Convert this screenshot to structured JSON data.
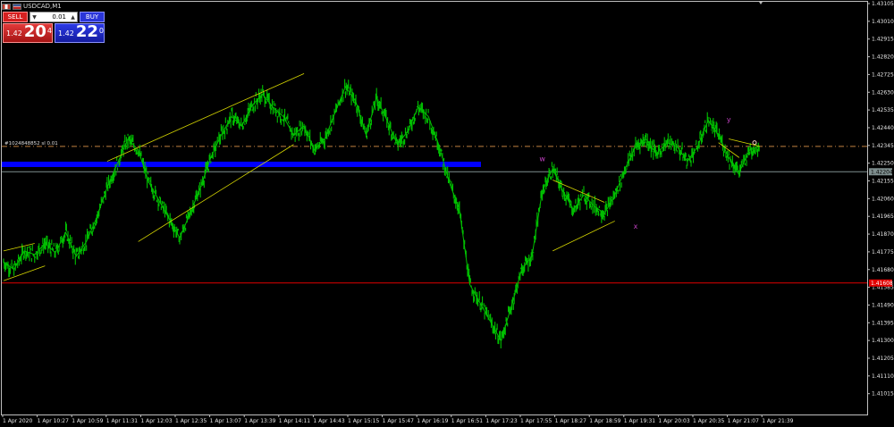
{
  "window": {
    "title": "USDCAD,M1"
  },
  "trade_panel": {
    "sell_label": "SELL",
    "buy_label": "BUY",
    "lot_value": "0.01",
    "sell_price": {
      "prefix": "1.42",
      "big": "20",
      "sup": "4"
    },
    "buy_price": {
      "prefix": "1.42",
      "big": "22",
      "sup": "0"
    }
  },
  "order_line_label": "#1024848852 sl 0.01",
  "bid_label": "1.42204",
  "stop_label": "1.41608",
  "wave_labels": [
    "w",
    "x",
    "y"
  ],
  "colors": {
    "background": "#000000",
    "candles": "#00c000",
    "zone": "#0000ff",
    "trendlines": "#d8d800",
    "bid_line": "#7f8f8f",
    "stop_line": "#e00000",
    "order_line": "#c08040",
    "wave_labels": "#c040c0"
  },
  "chart_data": {
    "type": "line",
    "ylim": [
      1.41,
      1.431
    ],
    "y_ticks": [
      "1.43105",
      "1.43010",
      "1.42915",
      "1.42820",
      "1.42725",
      "1.42630",
      "1.42535",
      "1.42440",
      "1.42345",
      "1.42250",
      "1.42155",
      "1.42060",
      "1.41965",
      "1.41870",
      "1.41775",
      "1.41680",
      "1.41585",
      "1.41490",
      "1.41395",
      "1.41300",
      "1.41205",
      "1.41110",
      "1.41015"
    ],
    "x_ticks": [
      "1 Apr 2020",
      "1 Apr 10:27",
      "1 Apr 10:59",
      "1 Apr 11:31",
      "1 Apr 12:03",
      "1 Apr 12:35",
      "1 Apr 13:07",
      "1 Apr 13:39",
      "1 Apr 14:11",
      "1 Apr 14:43",
      "1 Apr 15:15",
      "1 Apr 15:47",
      "1 Apr 16:19",
      "1 Apr 16:51",
      "1 Apr 17:23",
      "1 Apr 17:55",
      "1 Apr 18:27",
      "1 Apr 18:59",
      "1 Apr 19:31",
      "1 Apr 20:03",
      "1 Apr 20:35",
      "1 Apr 21:07",
      "1 Apr 21:39"
    ],
    "series": [
      {
        "values": [
          1.4172,
          1.4168,
          1.4178,
          1.4176,
          1.4182,
          1.4177,
          1.4188,
          1.4175,
          1.4183,
          1.4196,
          1.4212,
          1.4225,
          1.4238,
          1.4232,
          1.4215,
          1.4205,
          1.4195,
          1.4185,
          1.4198,
          1.4212,
          1.4228,
          1.424,
          1.425,
          1.4245,
          1.4256,
          1.4262,
          1.4255,
          1.425,
          1.424,
          1.4245,
          1.4232,
          1.4238,
          1.4252,
          1.4266,
          1.4258,
          1.424,
          1.426,
          1.4248,
          1.4235,
          1.4242,
          1.4255,
          1.425,
          1.4235,
          1.4215,
          1.42,
          1.416,
          1.415,
          1.414,
          1.413,
          1.4148,
          1.4168,
          1.4175,
          1.421,
          1.4222,
          1.421,
          1.42,
          1.4208,
          1.4202,
          1.4198,
          1.4208,
          1.4222,
          1.4234,
          1.4238,
          1.423,
          1.4236,
          1.4234,
          1.4226,
          1.4234,
          1.4248,
          1.424,
          1.4228,
          1.422,
          1.4232,
          1.4234
        ]
      }
    ],
    "bid_price": 1.42204,
    "stop_price": 1.41608,
    "order_price": 1.4234,
    "zone": {
      "from": 1.42258,
      "to": 1.42242
    },
    "trendlines": [
      {
        "x1": 0,
        "y1": 1.4178,
        "x2": 3,
        "y2": 1.4182
      },
      {
        "x1": 0,
        "y1": 1.4162,
        "x2": 4,
        "y2": 1.417
      },
      {
        "x1": 10,
        "y1": 1.4226,
        "x2": 29,
        "y2": 1.4273
      },
      {
        "x1": 13,
        "y1": 1.4183,
        "x2": 28,
        "y2": 1.4235
      },
      {
        "x1": 53,
        "y1": 1.4216,
        "x2": 58,
        "y2": 1.4204
      },
      {
        "x1": 53,
        "y1": 1.4178,
        "x2": 59,
        "y2": 1.4194
      },
      {
        "x1": 70,
        "y1": 1.4238,
        "x2": 73,
        "y2": 1.4234
      },
      {
        "x1": 69,
        "y1": 1.4236,
        "x2": 71,
        "y2": 1.4228
      }
    ],
    "wave_points": [
      {
        "label": "w",
        "x": 52,
        "y": 1.4226
      },
      {
        "label": "x",
        "x": 61,
        "y": 1.419
      },
      {
        "label": "y",
        "x": 70,
        "y": 1.4247
      }
    ]
  }
}
